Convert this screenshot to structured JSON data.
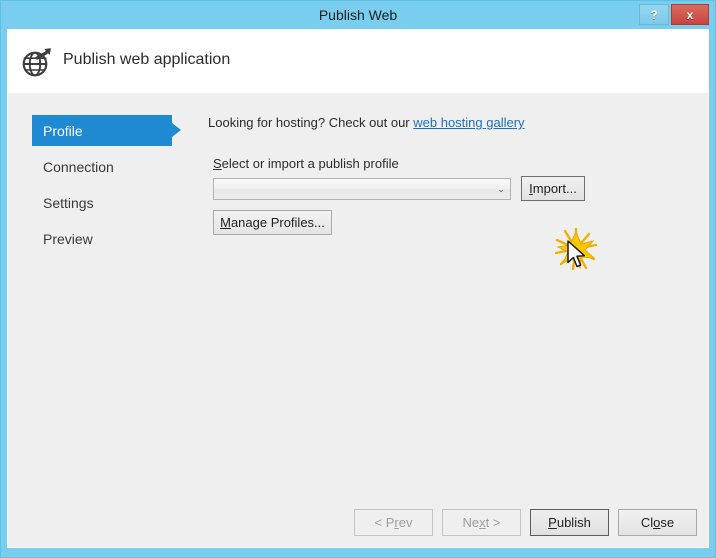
{
  "window": {
    "title": "Publish Web",
    "frame_color": "#79cdee",
    "titlebar_buttons": [
      {
        "name": "help-button",
        "label": "?"
      },
      {
        "name": "close-button",
        "label": "x"
      }
    ]
  },
  "header": {
    "icon": "globe-publish-icon",
    "title": "Publish web application"
  },
  "sidebar": {
    "accent_color": "#1f8ad2",
    "items": [
      {
        "label": "Profile",
        "active": true
      },
      {
        "label": "Connection",
        "active": false
      },
      {
        "label": "Settings",
        "active": false
      },
      {
        "label": "Preview",
        "active": false
      }
    ]
  },
  "main": {
    "hosting_prompt": "Looking for hosting? Check out our ",
    "hosting_link": "web hosting gallery",
    "hosting_link_color": "#1e6fc0",
    "profile_label_pre": "",
    "profile_label_accel": "S",
    "profile_label_post": "elect or import a publish profile",
    "combo": {
      "value": "",
      "placeholder": "",
      "chevron": "⌄"
    },
    "import_button": {
      "accel": "I",
      "rest": "mport..."
    },
    "manage_profiles_button": {
      "accel": "M",
      "rest": "anage Profiles..."
    }
  },
  "cursor": {
    "effect": "click-burst-starburst",
    "burst_color": "#f5b800",
    "pointer": "arrow-cursor"
  },
  "footer": {
    "buttons": [
      {
        "name": "prev-button",
        "pre": "< P",
        "accel": "r",
        "post": "ev",
        "disabled": true,
        "default": false
      },
      {
        "name": "next-button",
        "pre": "Ne",
        "accel": "x",
        "post": "t >",
        "disabled": true,
        "default": false
      },
      {
        "name": "publish-button",
        "pre": "",
        "accel": "P",
        "post": "ublish",
        "disabled": false,
        "default": true
      },
      {
        "name": "close-dialog-button",
        "pre": "Cl",
        "accel": "o",
        "post": "se",
        "disabled": false,
        "default": false
      }
    ]
  }
}
